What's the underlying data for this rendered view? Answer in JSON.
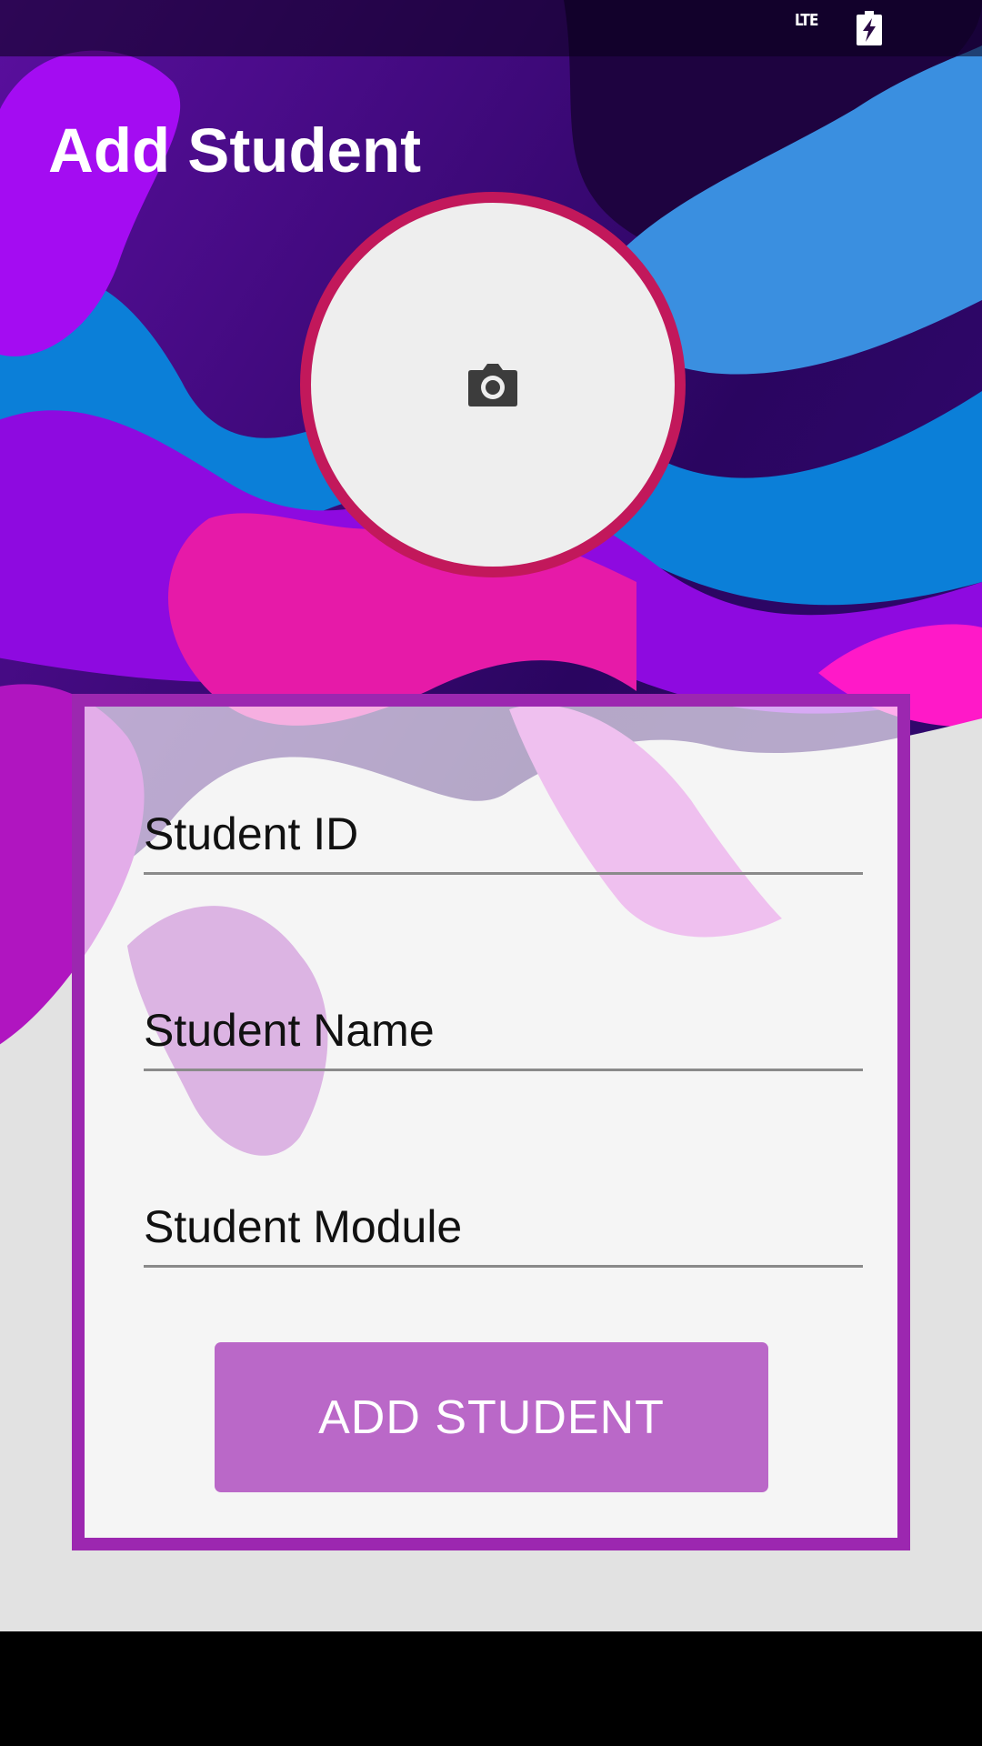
{
  "status_bar": {
    "network_label": "LTE",
    "battery_icon": "battery-charging-icon"
  },
  "header": {
    "title": "Add Student"
  },
  "photo": {
    "icon": "camera-icon",
    "ring_color": "#c2185b",
    "fill_color": "#eeeeee"
  },
  "form": {
    "border_color": "#9c27b0",
    "fields": {
      "student_id": {
        "placeholder": "Student ID",
        "value": ""
      },
      "student_name": {
        "placeholder": "Student Name",
        "value": ""
      },
      "student_module": {
        "placeholder": "Student Module",
        "value": ""
      }
    },
    "submit_label": "ADD STUDENT",
    "submit_color": "#ba68c8"
  }
}
